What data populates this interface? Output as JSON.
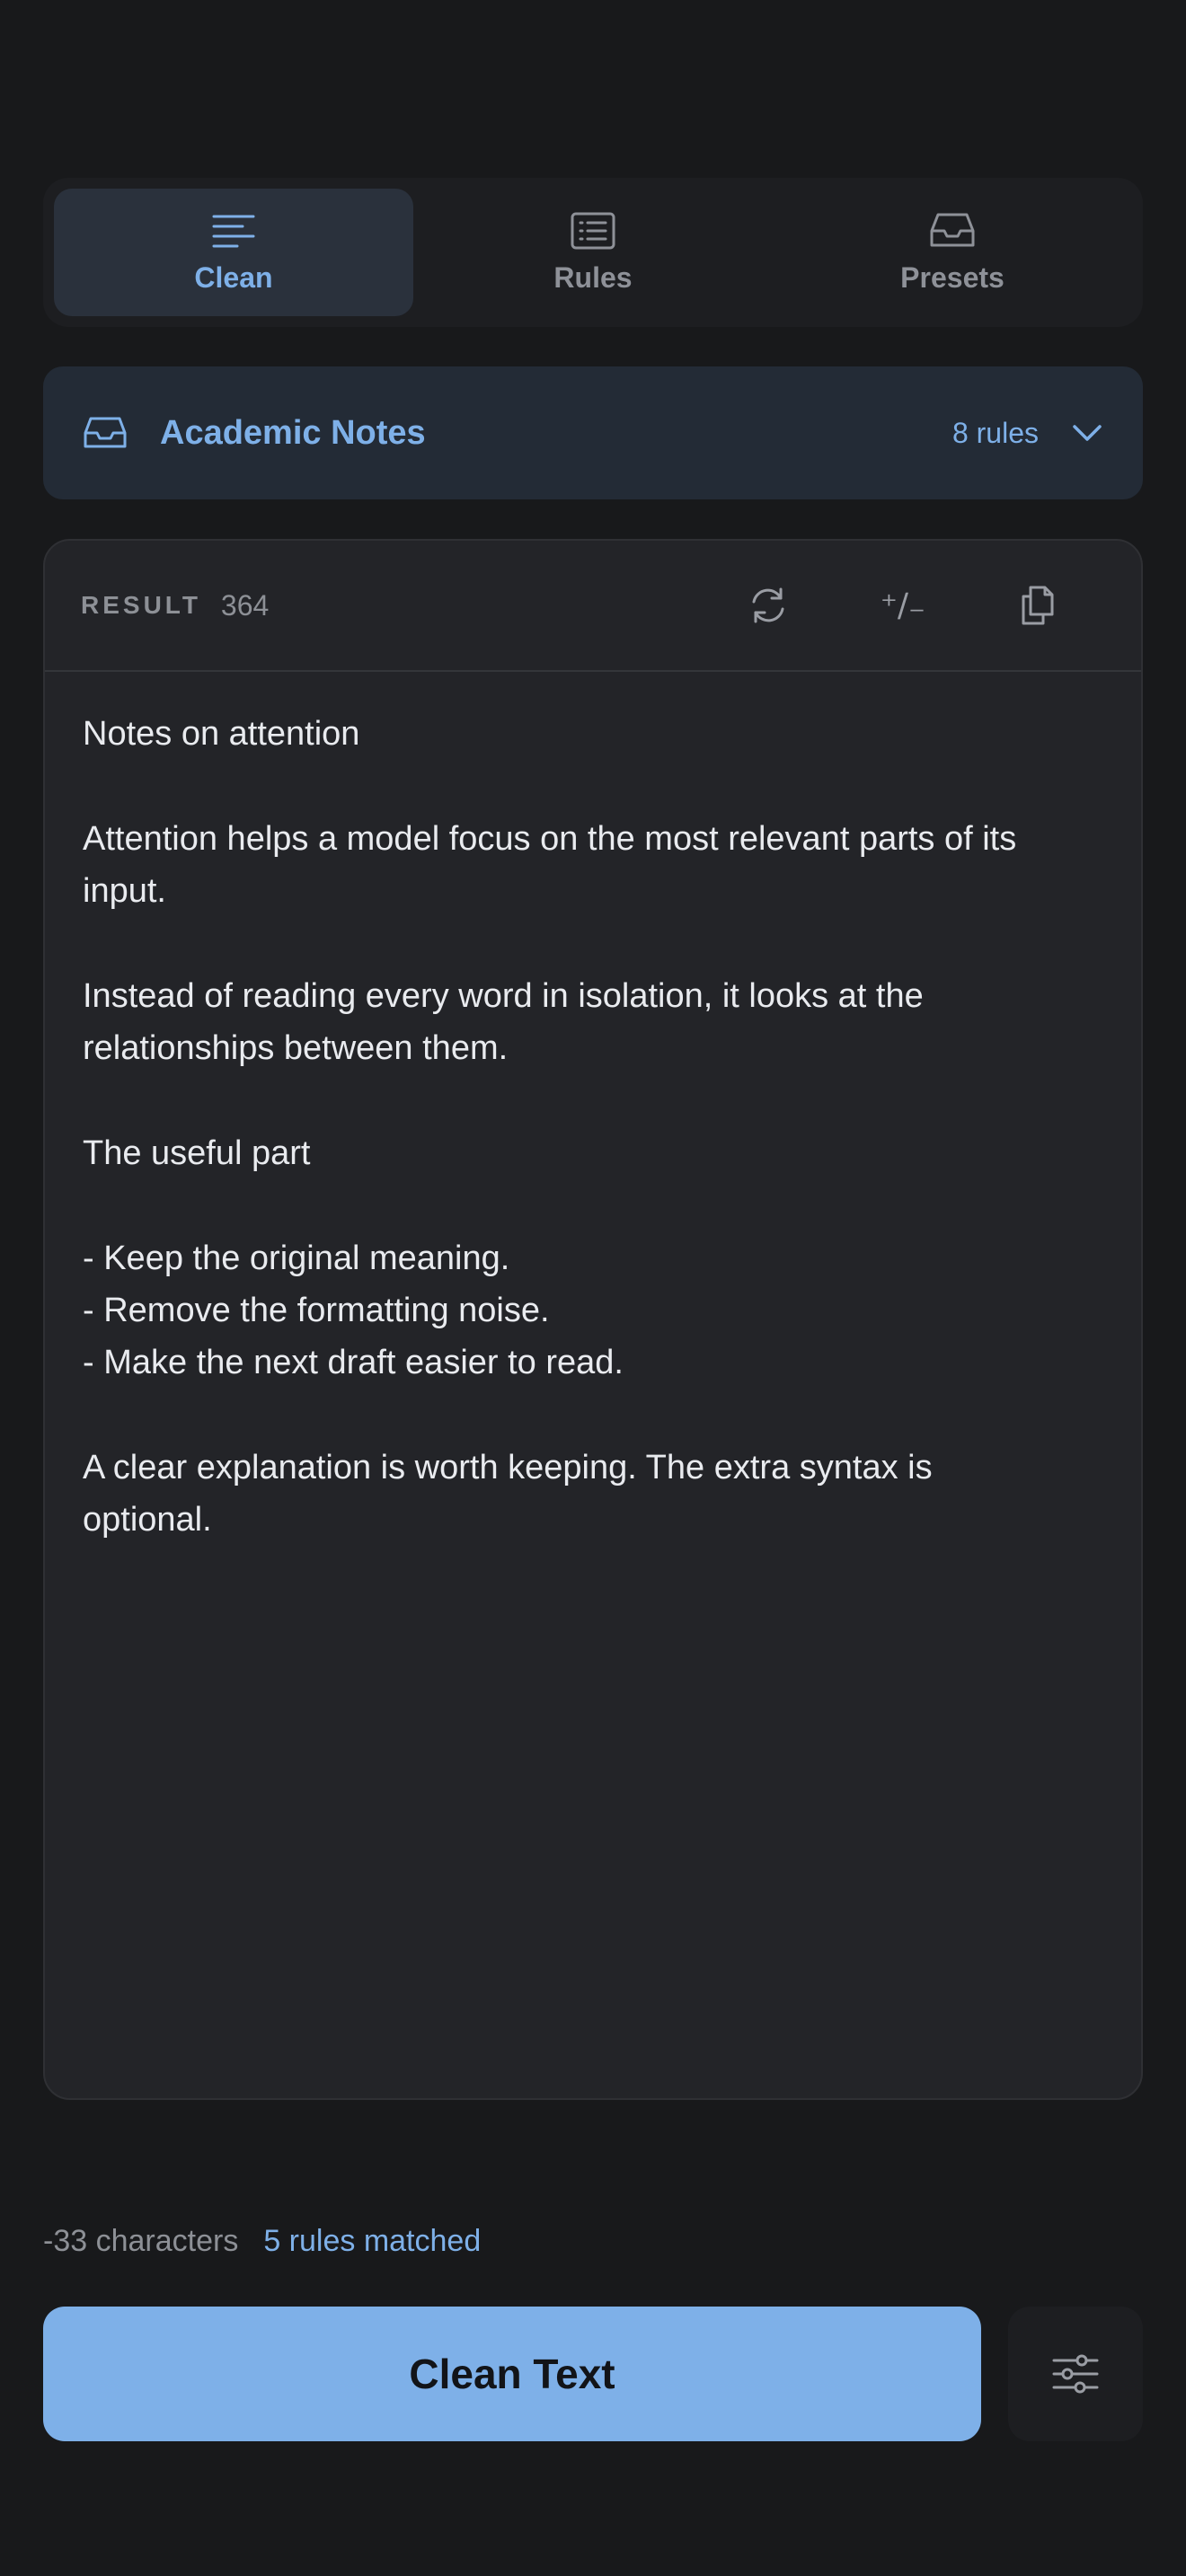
{
  "tabs": [
    {
      "label": "Clean",
      "icon": "align-left-icon",
      "active": true
    },
    {
      "label": "Rules",
      "icon": "list-icon",
      "active": false
    },
    {
      "label": "Presets",
      "icon": "inbox-icon",
      "active": false
    }
  ],
  "preset": {
    "name": "Academic Notes",
    "count": "8 rules",
    "icon": "inbox-icon"
  },
  "result": {
    "label": "RESULT",
    "count": "364",
    "plusminus": "⁺∕₋",
    "paragraphs": [
      "Notes on attention",
      "Attention helps a model focus on the most relevant parts of its input.",
      "Instead of reading every word in isolation, it looks at the relationships between them.",
      "The useful part"
    ],
    "list": [
      "- Keep the original meaning.",
      "- Remove the formatting noise.",
      "- Make the next draft easier to read."
    ],
    "closing": "A clear explanation is worth keeping. The extra syntax is optional."
  },
  "stats": {
    "chars": "-33 characters",
    "rules": "5 rules matched"
  },
  "actions": {
    "clean_label": "Clean Text"
  },
  "colors": {
    "accent": "#7eb0e8",
    "background": "#18191b",
    "card": "#232428"
  }
}
